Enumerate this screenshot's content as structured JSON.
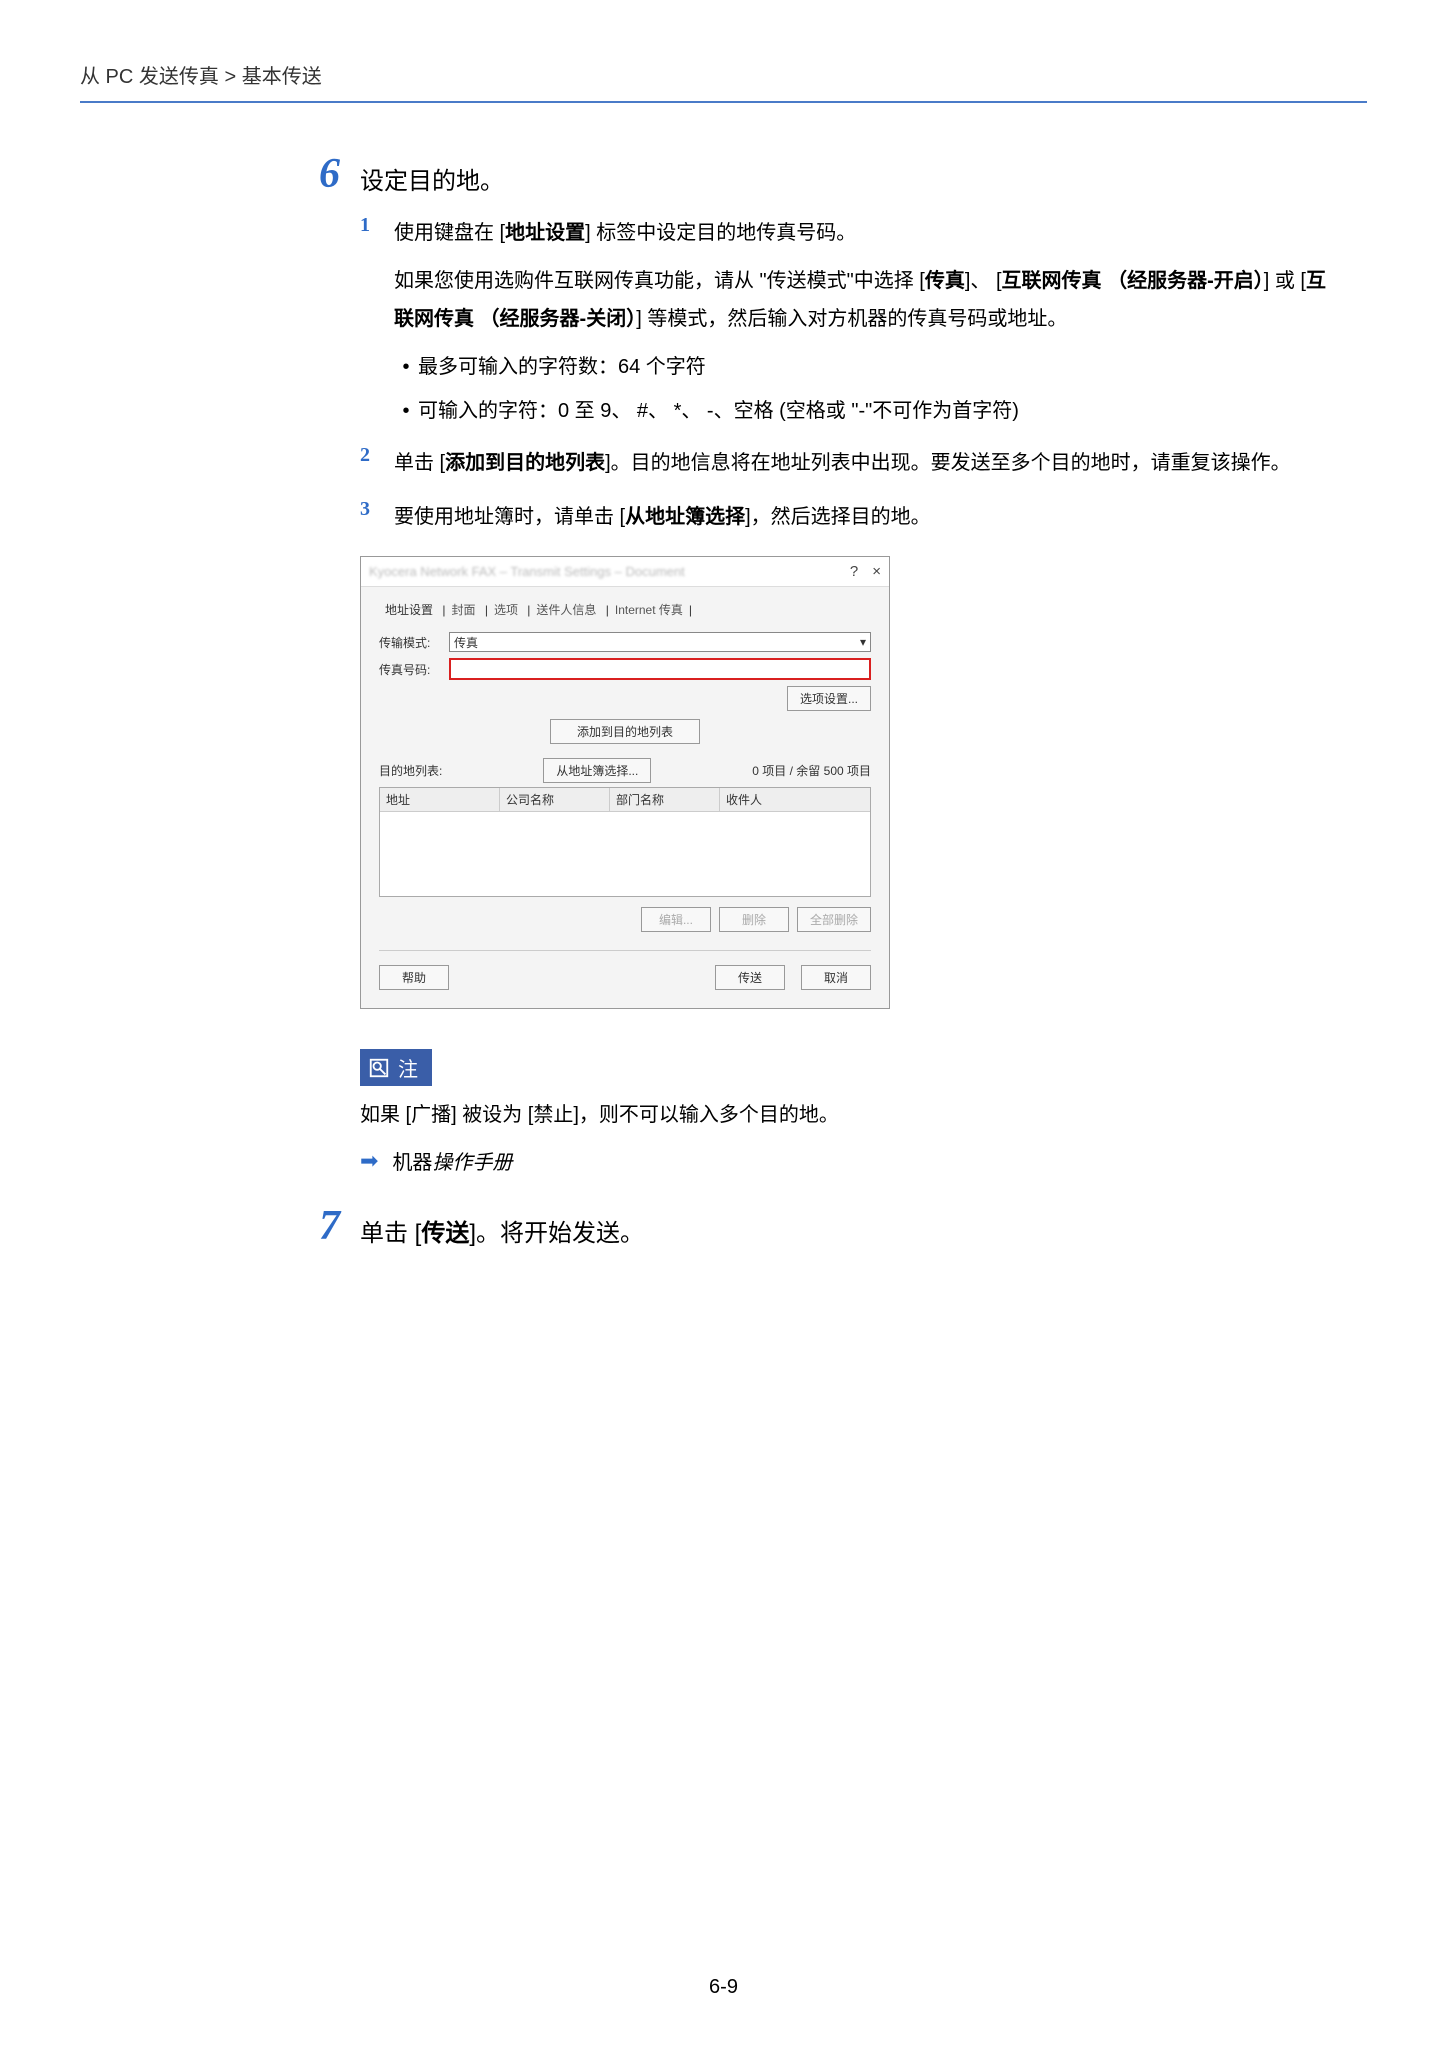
{
  "header": {
    "breadcrumb": "从 PC 发送传真 > 基本传送"
  },
  "step6": {
    "num": "6",
    "title": "设定目的地。",
    "sub1": {
      "num": "1",
      "line1_a": "使用键盘在 [",
      "line1_b": "地址设置",
      "line1_c": "] 标签中设定目的地传真号码。",
      "para2_a": "如果您使用选购件互联网传真功能，请从 \"传送模式\"中选择 [",
      "para2_b": "传真",
      "para2_c": "]、 [",
      "para2_d": "互联网传真 （经服务器-开启）",
      "para2_e": "] 或 [",
      "para2_f": "互联网传真 （经服务器-关闭）",
      "para2_g": "] 等模式，然后输入对方机器的传真号码或地址。",
      "bullet1": "最多可输入的字符数：64 个字符",
      "bullet2": "可输入的字符：0 至 9、 #、 *、 -、空格 (空格或 \"-\"不可作为首字符)"
    },
    "sub2": {
      "num": "2",
      "a": "单击 [",
      "b": "添加到目的地列表",
      "c": "]。目的地信息将在地址列表中出现。要发送至多个目的地时，请重复该操作。"
    },
    "sub3": {
      "num": "3",
      "a": "要使用地址簿时，请单击 [",
      "b": "从地址簿选择",
      "c": "]，然后选择目的地。"
    }
  },
  "dialog": {
    "title": "Kyocera Network FAX – Transmit Settings – Document",
    "help": "?",
    "close": "×",
    "tabs": {
      "t1": "地址设置",
      "t2": "封面",
      "t3": "选项",
      "t4": "送件人信息",
      "t5": "Internet 传真"
    },
    "mode_label": "传输模式:",
    "mode_value": "传真",
    "faxno_label": "传真号码:",
    "option_btn": "选项设置...",
    "add_btn": "添加到目的地列表",
    "list_label": "目的地列表:",
    "from_ab_btn": "从地址簿选择...",
    "count_text": "0 项目 / 余留 500 项目",
    "th1": "地址",
    "th2": "公司名称",
    "th3": "部门名称",
    "th4": "收件人",
    "edit_btn": "编辑...",
    "del_btn": "删除",
    "delall_btn": "全部删除",
    "help_btn": "帮助",
    "send_btn": "传送",
    "cancel_btn": "取消"
  },
  "note": {
    "label": "注",
    "body_a": "如果 [",
    "body_b": "广播",
    "body_c": "] 被设为 [",
    "body_d": "禁止",
    "body_e": "]，则不可以输入多个目的地。",
    "ref_a": "机器",
    "ref_b": "操作手册"
  },
  "step7": {
    "num": "7",
    "a": "单击 [",
    "b": "传送",
    "c": "]。将开始发送。"
  },
  "page_number": "6-9"
}
